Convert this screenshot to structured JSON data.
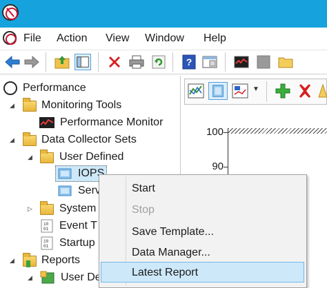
{
  "menu": {
    "items": [
      {
        "label": "File"
      },
      {
        "label": "Action"
      },
      {
        "label": "View"
      },
      {
        "label": "Window"
      },
      {
        "label": "Help"
      }
    ]
  },
  "toolbar": {
    "icons": [
      "back-arrow-icon",
      "forward-arrow-icon",
      "up-folder-icon",
      "show-hide-tree-icon",
      "delete-icon",
      "print-icon",
      "refresh-icon",
      "help-icon",
      "properties-icon",
      "performance-monitor-icon",
      "stop-icon",
      "folder-icon"
    ]
  },
  "tree": {
    "items": [
      {
        "label": "Performance"
      },
      {
        "label": "Monitoring Tools"
      },
      {
        "label": "Performance Monitor"
      },
      {
        "label": "Data Collector Sets"
      },
      {
        "label": "User Defined"
      },
      {
        "label": "IOPS"
      },
      {
        "label": "Serv"
      },
      {
        "label": "System"
      },
      {
        "label": "Event T"
      },
      {
        "label": "Startup"
      },
      {
        "label": "Reports"
      },
      {
        "label": "User De"
      }
    ]
  },
  "graph": {
    "ticks": [
      "100",
      "90"
    ]
  },
  "context_menu": {
    "items": [
      {
        "label": "Start",
        "enabled": true
      },
      {
        "label": "Stop",
        "enabled": false
      },
      {
        "label": "Save Template...",
        "enabled": true
      },
      {
        "label": "Data Manager...",
        "enabled": true
      },
      {
        "label": "Latest Report",
        "enabled": true,
        "highlighted": true
      }
    ]
  },
  "colors": {
    "titlebar": "#16a3dd",
    "selection": "#cde8f8",
    "disabled_text": "#a0a0a0"
  }
}
